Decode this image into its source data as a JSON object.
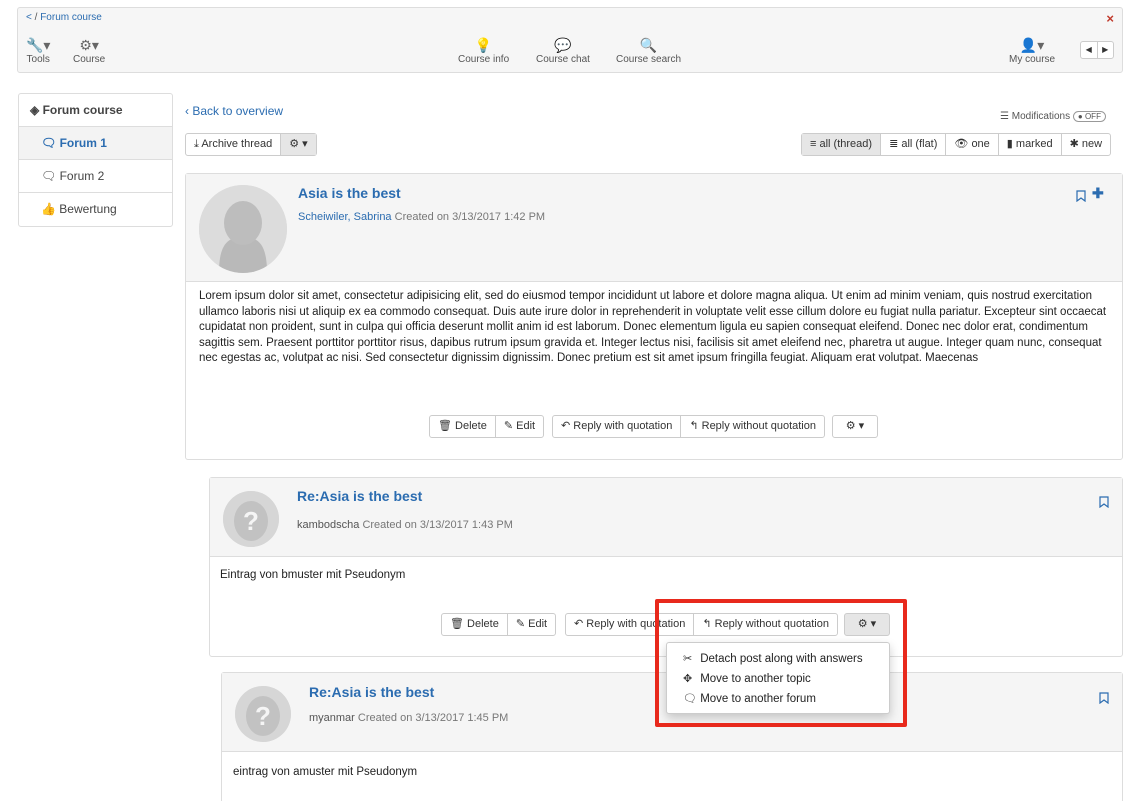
{
  "breadcrumb": {
    "back": "<",
    "sep": "/",
    "label": "Forum course"
  },
  "topbar": {
    "close": "×",
    "tools": "Tools",
    "course": "Course",
    "course_info": "Course info",
    "course_chat": "Course chat",
    "course_search": "Course search",
    "my_course": "My course",
    "prev": "◀",
    "next": "▶"
  },
  "sidebar": {
    "title": "Forum course",
    "items": [
      {
        "label": "Forum 1",
        "active": true
      },
      {
        "label": "Forum 2",
        "active": false
      },
      {
        "label": "Bewertung",
        "active": false
      }
    ]
  },
  "content": {
    "back": "Back to overview",
    "modifications": "Modifications",
    "modifications_state": "OFF",
    "archive": "Archive thread",
    "views": [
      "all (thread)",
      "all (flat)",
      "one",
      "marked",
      "new"
    ],
    "active_view": "all (thread)"
  },
  "actions": {
    "delete": "Delete",
    "edit": "Edit",
    "reply_quote": "Reply with quotation",
    "reply_noquote": "Reply without quotation"
  },
  "posts": [
    {
      "title": "Asia is the best",
      "author": "Scheiwiler, Sabrina",
      "created": "Created on 3/13/2017 1:42 PM",
      "body": "Lorem ipsum dolor sit amet, consectetur adipisicing elit, sed do eiusmod tempor incididunt ut labore et dolore magna aliqua. Ut enim ad minim veniam, quis nostrud exercitation ullamco laboris nisi ut aliquip ex ea commodo consequat. Duis aute irure dolor in reprehenderit in voluptate velit esse cillum dolore eu fugiat nulla pariatur. Excepteur sint occaecat cupidatat non proident, sunt in culpa qui officia deserunt mollit anim id est laborum. Donec elementum ligula eu sapien consequat eleifend. Donec nec dolor erat, condimentum sagittis sem. Praesent porttitor porttitor risus, dapibus rutrum ipsum gravida et. Integer lectus nisi, facilisis sit amet eleifend nec, pharetra ut augue. Integer quam nunc, consequat nec egestas ac, volutpat ac nisi. Sed consectetur dignissim dignissim. Donec pretium est sit amet ipsum fringilla feugiat. Aliquam erat volutpat. Maecenas"
    },
    {
      "title": "Re:Asia is the best",
      "author": "kambodscha",
      "created": "Created on 3/13/2017 1:43 PM",
      "body": "Eintrag von bmuster mit Pseudonym"
    },
    {
      "title": "Re:Asia is the best",
      "author": "myanmar",
      "created": "Created on 3/13/2017 1:45 PM",
      "body": "eintrag von amuster mit Pseudonym"
    }
  ],
  "dropdown": {
    "items": [
      {
        "icon": "detach-icon",
        "label": "Detach post along with answers"
      },
      {
        "icon": "move-icon",
        "label": "Move to another topic"
      },
      {
        "icon": "forum-icon",
        "label": "Move to another forum"
      }
    ]
  },
  "colors": {
    "link": "#2b6cb0",
    "highlight": "#e8291c",
    "close": "#c0392b"
  }
}
